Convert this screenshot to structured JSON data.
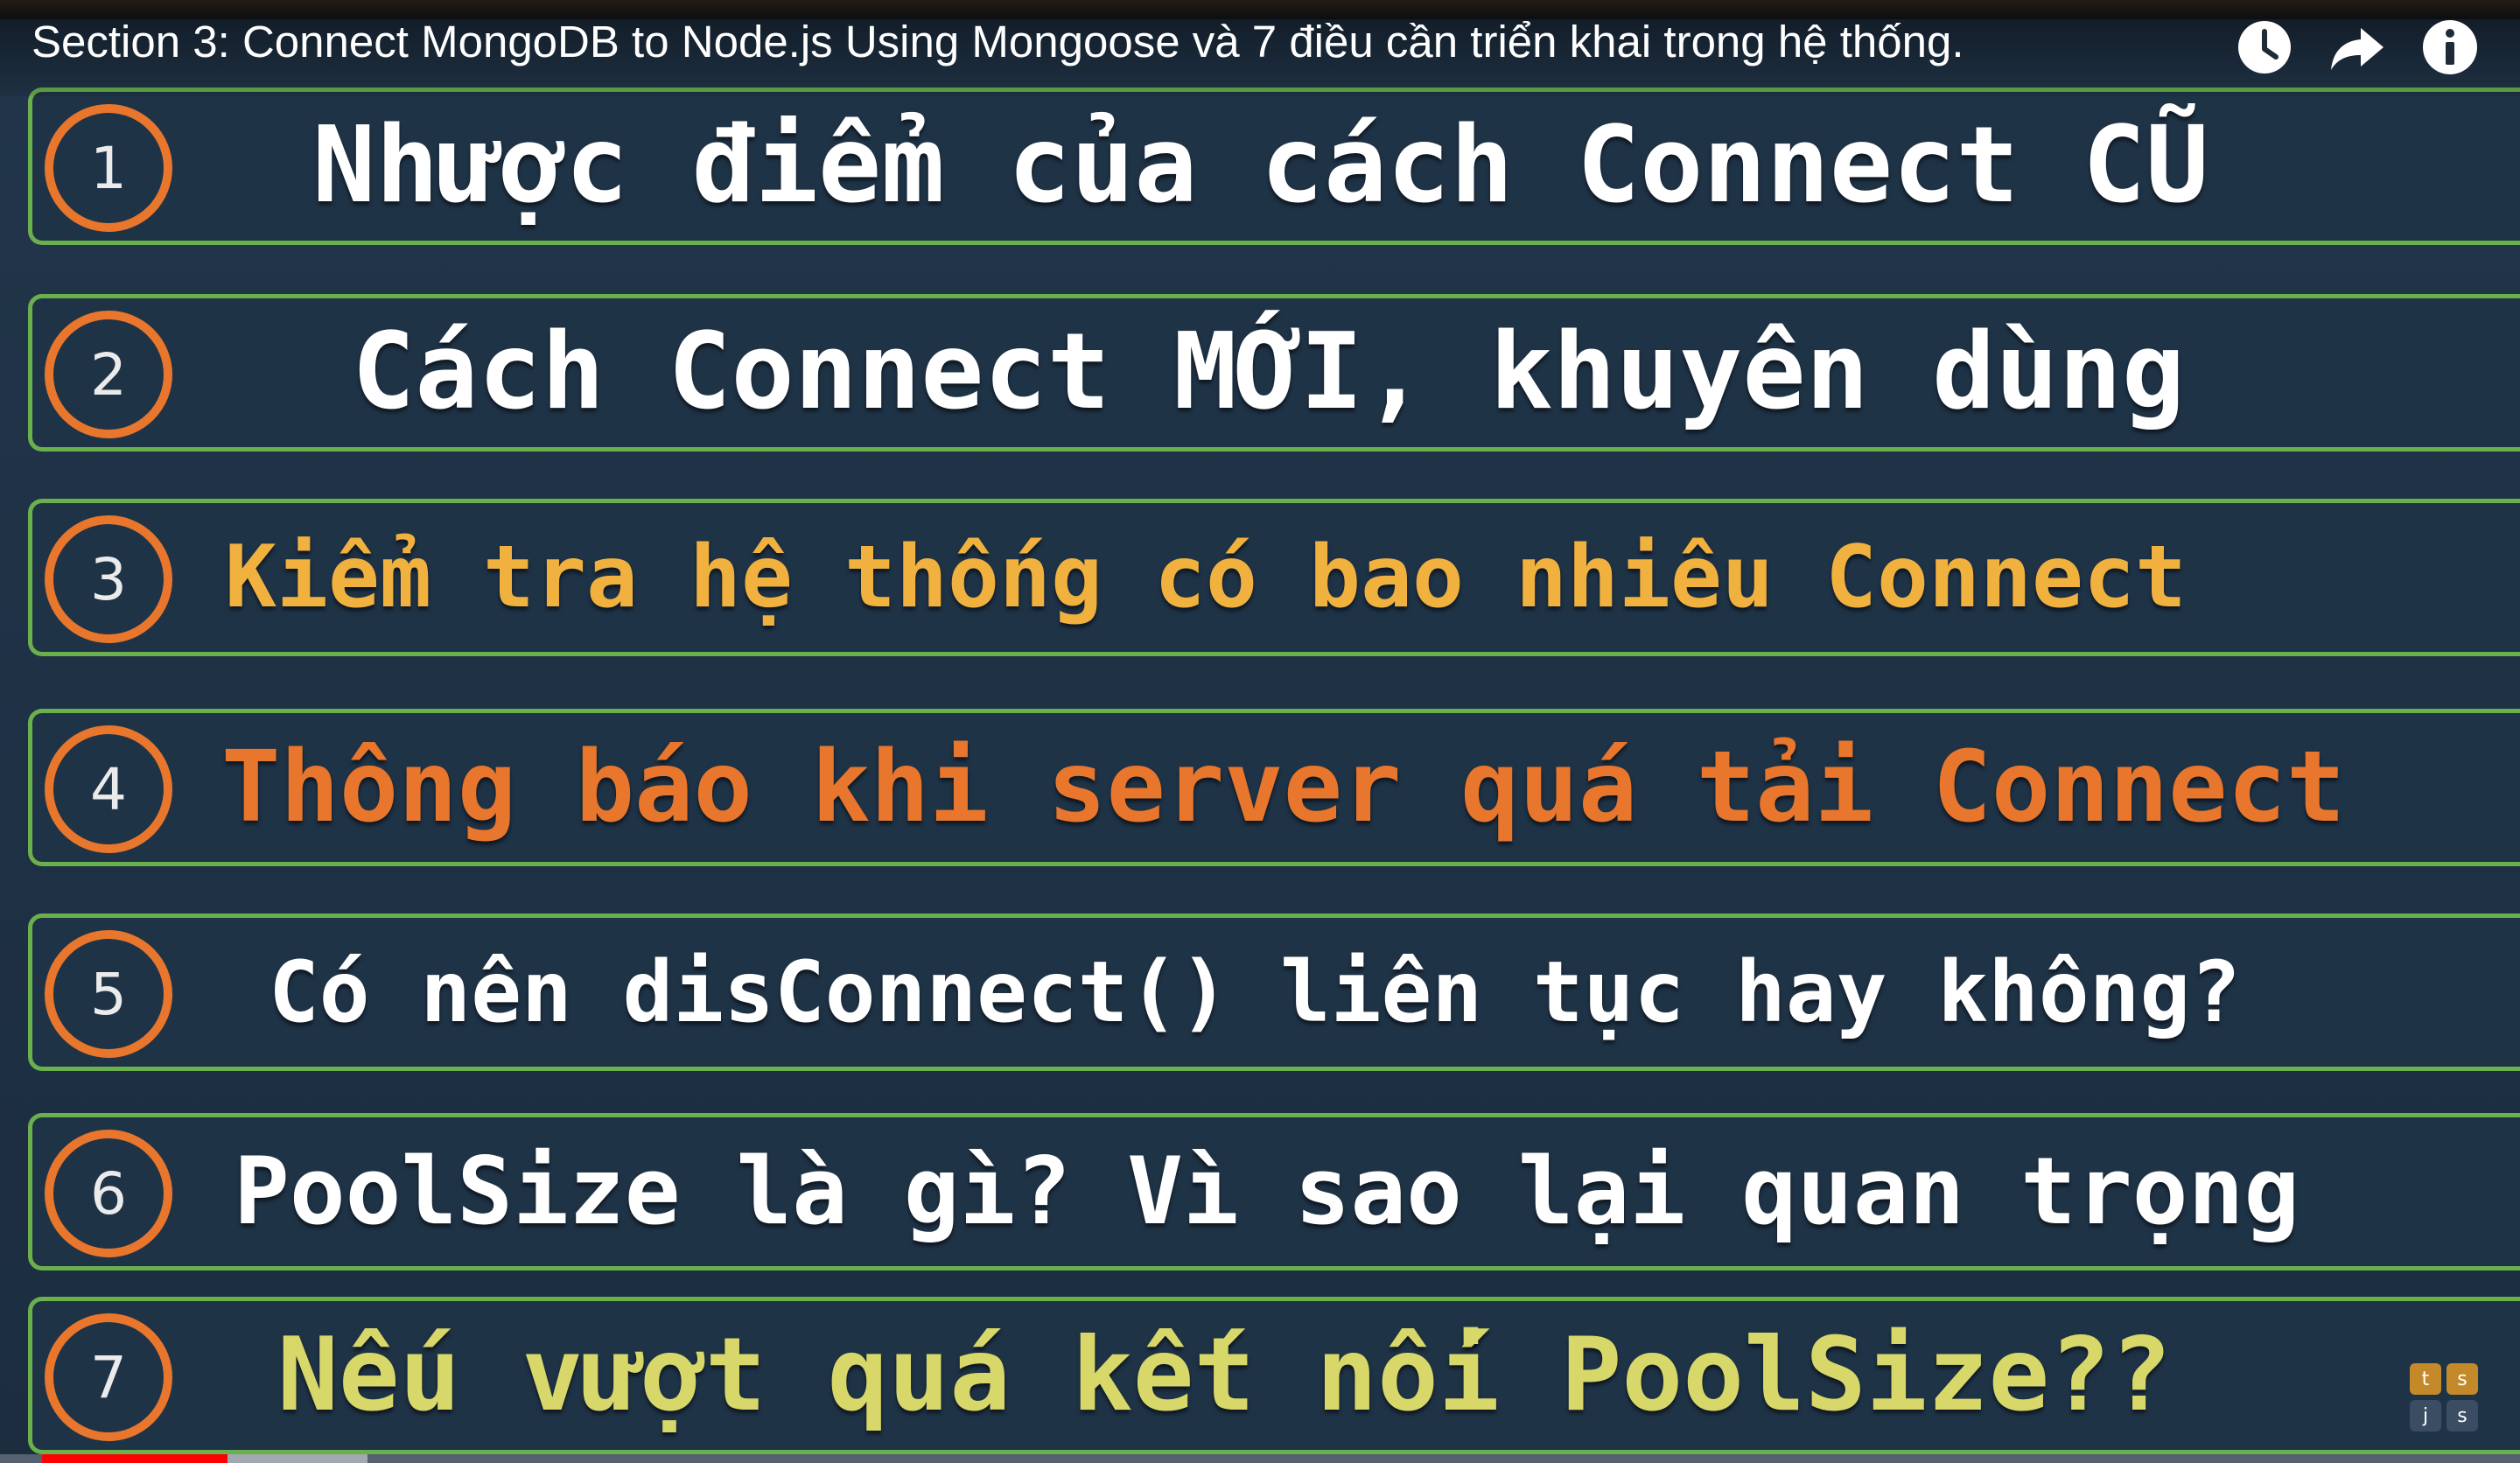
{
  "video": {
    "title": "Section 3: Connect MongoDB to Node.js Using Mongoose và 7 điều cần triển khai trong hệ thống."
  },
  "header": {
    "watch_later_icon": "clock-icon",
    "share_icon": "share-arrow-icon",
    "info_icon": "info-icon"
  },
  "slide": {
    "items": [
      {
        "number": "1",
        "text": "Nhược điểm của cách Connect CŨ",
        "color": "#ffffff"
      },
      {
        "number": "2",
        "text": "Cách Connect MỚI, khuyên dùng",
        "color": "#ffffff"
      },
      {
        "number": "3",
        "text": "Kiểm tra hệ thống có bao nhiêu Connect",
        "color": "#f0b13f"
      },
      {
        "number": "4",
        "text": "Thông báo khi server quá tải Connect",
        "color": "#e8762c"
      },
      {
        "number": "5",
        "text": "Có nên disConnect() liên tục hay không?",
        "color": "#ffffff"
      },
      {
        "number": "6",
        "text": "PoolSize là gì? Vì sao lại quan trọng",
        "color": "#ffffff"
      },
      {
        "number": "7",
        "text": "Nếu vượt quá kết nối PoolSize??",
        "color": "#d7d76a"
      }
    ]
  },
  "watermark": {
    "cells": [
      "t",
      "s",
      "j",
      "s"
    ]
  },
  "colors": {
    "row_border": "#6ab04c",
    "badge_ring": "#e8762c",
    "progress": "#ff0000"
  }
}
